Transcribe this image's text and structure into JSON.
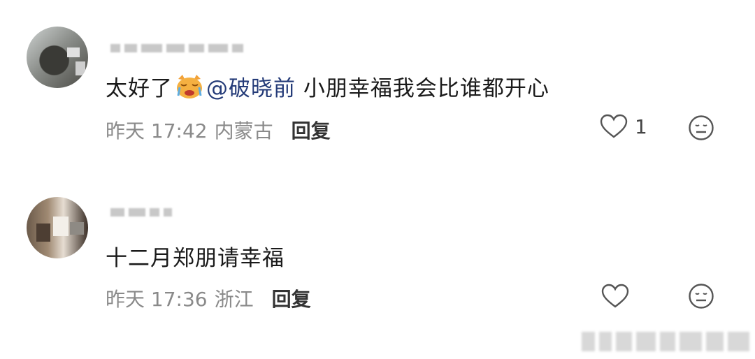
{
  "comments": [
    {
      "content_prefix": "太好了",
      "emoji": "cat-crying-emoji",
      "mention": "@破晓前",
      "content_suffix": " 小朋幸福我会比谁都开心",
      "time": "昨天 17:42",
      "location": "内蒙古",
      "reply_label": "回复",
      "like_count": "1"
    },
    {
      "content_prefix": "十二月郑朋请幸福",
      "time": "昨天 17:36",
      "location": "浙江",
      "reply_label": "回复",
      "like_count": ""
    }
  ],
  "icons": {
    "like": "heart-outline-icon",
    "dislike": "neutral-face-icon"
  },
  "colors": {
    "mention": "#243b78",
    "meta_text": "#8a8a8a",
    "reply_text": "#333333"
  }
}
